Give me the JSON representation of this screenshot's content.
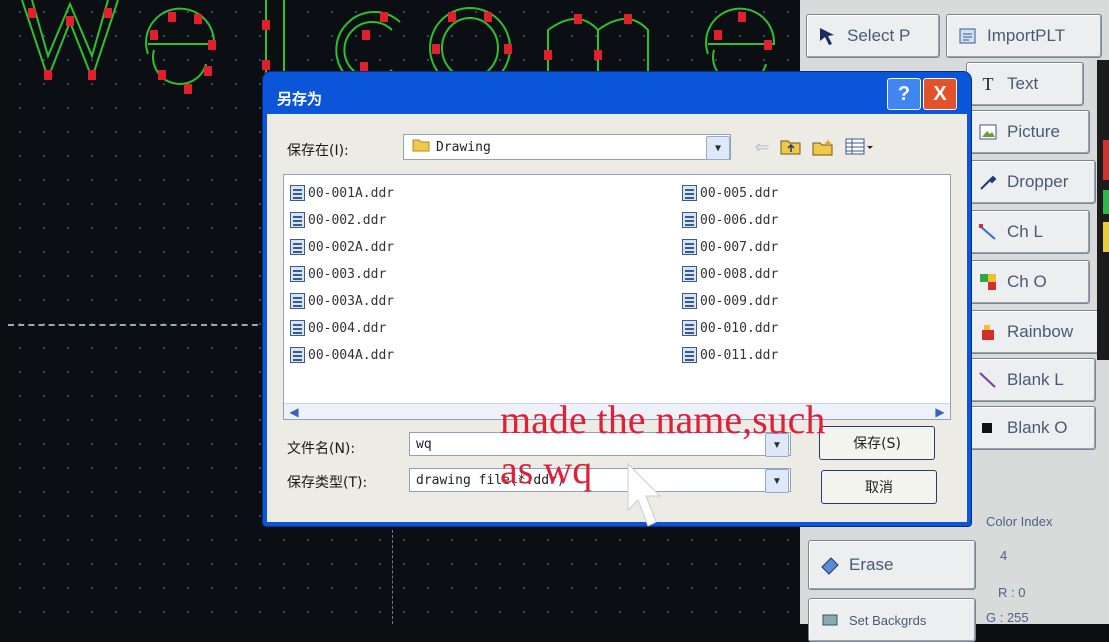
{
  "toolbar": {
    "select": "Select P",
    "import": "ImportPLT",
    "text": "Text",
    "picture": "Picture",
    "dropper": "Dropper",
    "ch_l": "Ch L",
    "ch_o": "Ch O",
    "rainbow": "Rainbow",
    "blank_l": "Blank L",
    "blank_o": "Blank O",
    "erase": "Erase",
    "set_background": "Set Backgrds"
  },
  "color": {
    "label": "Color Index",
    "index": "4",
    "r": "R : 0",
    "g": "G : 255"
  },
  "dialog": {
    "title": "另存为",
    "help": "?",
    "close": "X",
    "save_in_label": "保存在(I):",
    "save_in_value": "Drawing",
    "files_left": [
      "00-001A.ddr",
      "00-002.ddr",
      "00-002A.ddr",
      "00-003.ddr",
      "00-003A.ddr",
      "00-004.ddr",
      "00-004A.ddr"
    ],
    "files_right": [
      "00-005.ddr",
      "00-006.ddr",
      "00-007.ddr",
      "00-008.ddr",
      "00-009.ddr",
      "00-010.ddr",
      "00-011.ddr"
    ],
    "filename_label": "文件名(N):",
    "filename_value": "wq",
    "filetype_label": "保存类型(T):",
    "filetype_value": "drawing file(*.ddr)",
    "save_button": "保存(S)",
    "cancel_button": "取消"
  },
  "annotation": {
    "line1": "made the name,such",
    "line2": "as wq"
  }
}
